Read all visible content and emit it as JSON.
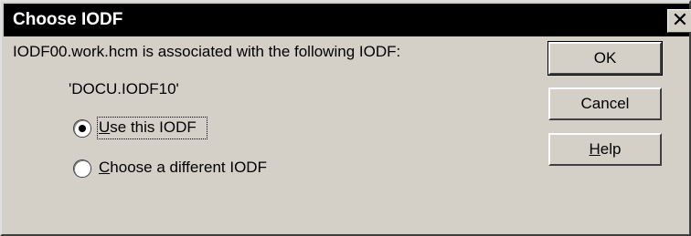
{
  "window": {
    "title": "Choose IODF",
    "close_glyph": "✕"
  },
  "message": {
    "line": "IODF00.work.hcm is associated with the following IODF:",
    "iodf_name": "'DOCU.IODF10'"
  },
  "options": [
    {
      "label": "Use this IODF",
      "mnemonic": "U",
      "rest": "se this IODF",
      "selected": true
    },
    {
      "label": "Choose a different IODF",
      "mnemonic": "C",
      "rest": "hoose a different IODF",
      "selected": false
    }
  ],
  "buttons": {
    "ok": "OK",
    "cancel": "Cancel",
    "help_mnemonic": "H",
    "help_rest": "elp"
  },
  "colors": {
    "dialog_bg": "#d4d0c8",
    "titlebar_bg": "#000000",
    "title_text": "#ffffff"
  }
}
